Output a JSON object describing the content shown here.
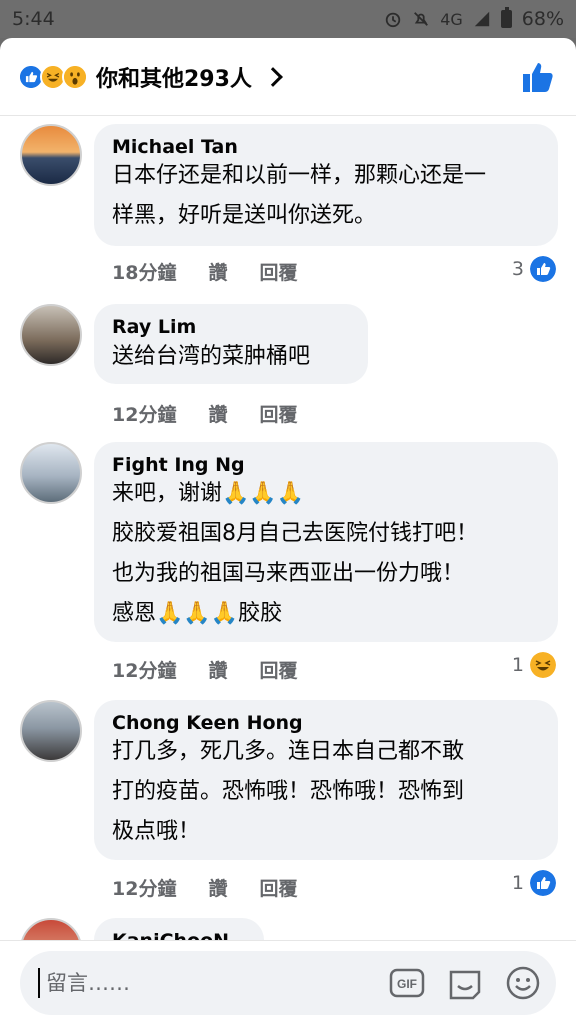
{
  "status_bar": {
    "time": "5:44",
    "network": "4G",
    "battery": "68%"
  },
  "header": {
    "reaction_summary": "你和其他293人",
    "reaction_icons": [
      "like-icon",
      "laugh-icon",
      "wow-icon"
    ]
  },
  "comments": [
    {
      "name": "Michael Tan",
      "text": "日本仔还是和以前一样，那颗心还是一\n样黑，好听是送叫你送死。",
      "time": "18分鐘",
      "like": "讚",
      "reply": "回覆",
      "reaction_count": "3",
      "reaction_type": "like"
    },
    {
      "name": "Ray Lim",
      "text": "送给台湾的菜肿桶吧",
      "time": "12分鐘",
      "like": "讚",
      "reply": "回覆",
      "reaction_count": "",
      "reaction_type": ""
    },
    {
      "name": "Fight Ing Ng",
      "text": "来吧，谢谢🙏🙏🙏\n胶胶爱祖国8月自己去医院付钱打吧！\n也为我的祖国马来西亚出一份力哦！\n感恩🙏🙏🙏胶胶",
      "time": "12分鐘",
      "like": "讚",
      "reply": "回覆",
      "reaction_count": "1",
      "reaction_type": "laugh"
    },
    {
      "name": "Chong Keen Hong",
      "text": "打几多，死几多。连日本自己都不敢\n打的疫苗。恐怖哦！恐怖哦！恐怖到\n极点哦！",
      "time": "12分鐘",
      "like": "讚",
      "reply": "回覆",
      "reaction_count": "1",
      "reaction_type": "like"
    },
    {
      "name": "KaniChooN",
      "text": "",
      "time": "",
      "like": "",
      "reply": "",
      "reaction_count": "",
      "reaction_type": ""
    }
  ],
  "composer": {
    "placeholder": "留言……",
    "gif_label": "GIF"
  },
  "colors": {
    "accent": "#1b74e4",
    "bubble": "#f0f2f5",
    "meta_text": "#65676b",
    "laugh": "#f7b125"
  }
}
